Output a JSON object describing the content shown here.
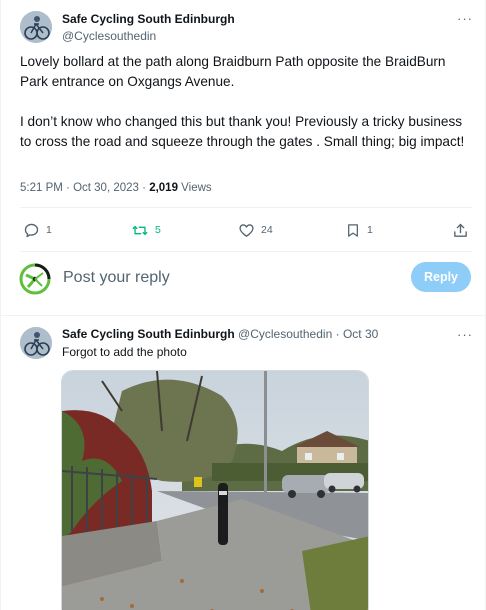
{
  "tweet": {
    "author_name": "Safe Cycling South Edinburgh",
    "author_handle": "@Cyclesouthedin",
    "more_icon_label": "···",
    "paragraph1": "Lovely  bollard at the path along Braidburn  Path  opposite the BraidBurn Park entrance  on Oxgangs Avenue.",
    "paragraph2": "I don’t know who changed this but thank you!  Previously a tricky business to cross the road and squeeze through the gates . Small thing; big impact!",
    "time": "5:21 PM",
    "separator": "·",
    "date": "Oct 30, 2023",
    "views_count": "2,019",
    "views_label": "Views"
  },
  "actions": {
    "replies": "1",
    "retweets": "5",
    "likes": "24",
    "bookmarks": "1",
    "retweet_color": "#00ba7c"
  },
  "reply_box": {
    "placeholder": "Post your reply",
    "button_label": "Reply",
    "button_color": "#8ecdf8"
  },
  "reply_tweet": {
    "author_name": "Safe Cycling South Edinburgh",
    "author_handle": "@Cyclesouthedin",
    "separator": "·",
    "date": "Oct 30",
    "more_icon_label": "···",
    "text": "Forgot to add the photo"
  },
  "icons": [
    "reply-icon",
    "retweet-icon",
    "like-icon",
    "bookmark-icon",
    "share-icon",
    "more-icon"
  ]
}
